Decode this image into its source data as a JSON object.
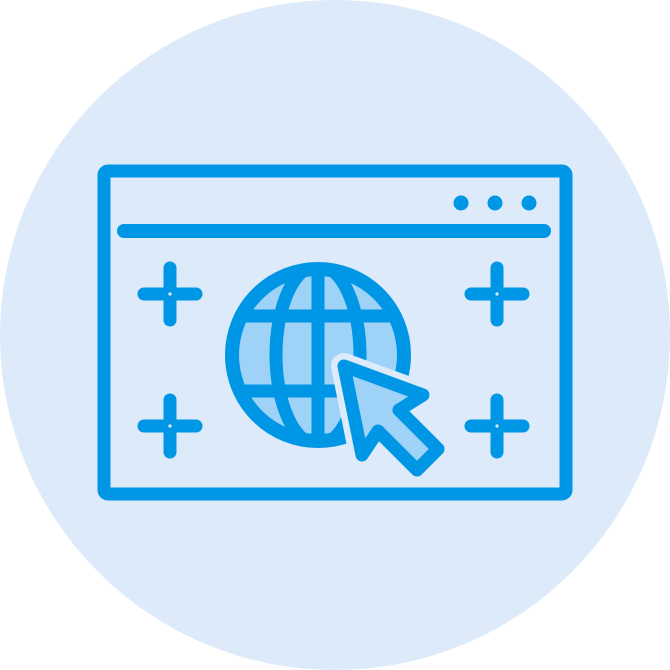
{
  "icon": {
    "name": "web-browser-globe-cursor-icon",
    "colors": {
      "background_circle": "#DCEAF9",
      "stroke": "#0096E6",
      "globe_fill": "#9ED3F7"
    }
  }
}
